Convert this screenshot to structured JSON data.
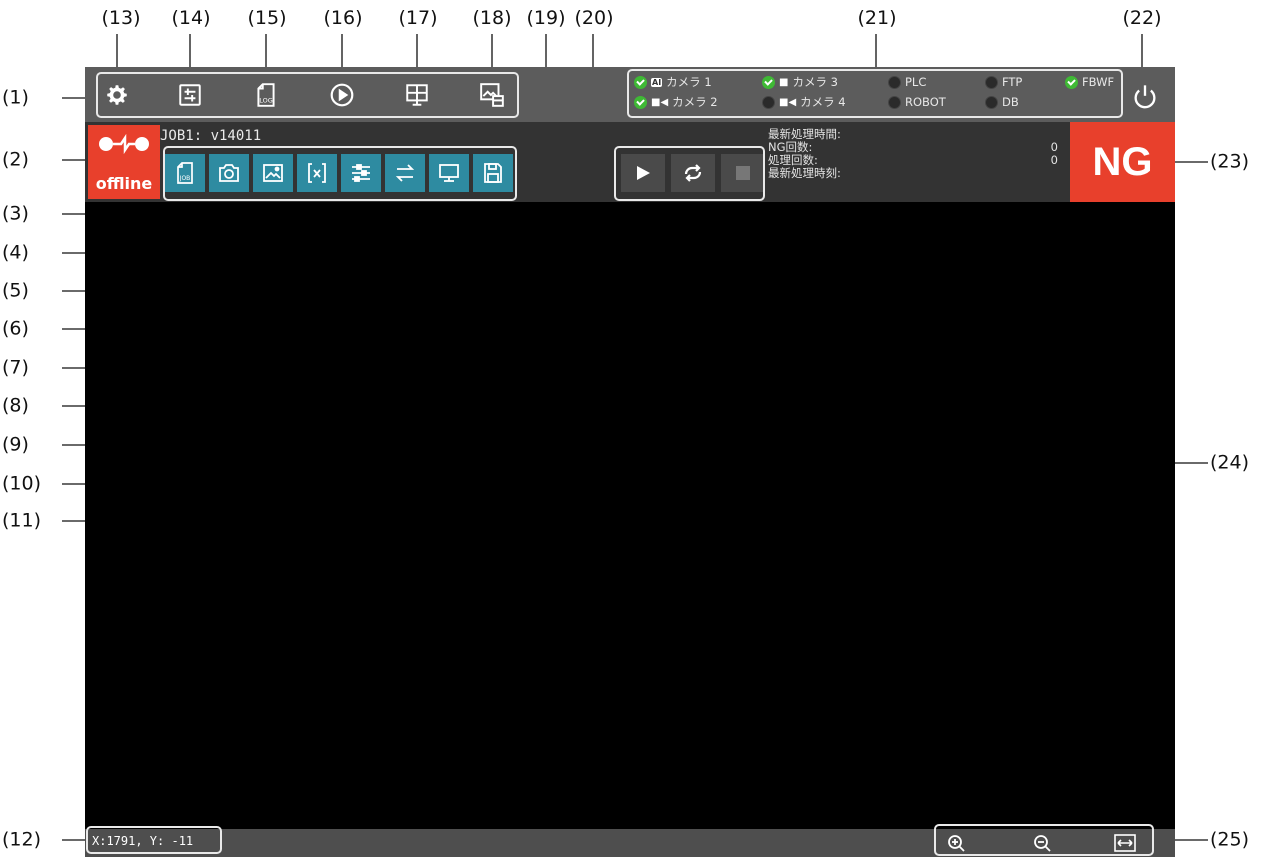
{
  "callouts": {
    "c1": "(1)",
    "c2": "(2)",
    "c3": "(3)",
    "c4": "(4)",
    "c5": "(5)",
    "c6": "(6)",
    "c7": "(7)",
    "c8": "(8)",
    "c9": "(9)",
    "c10": "(10)",
    "c11": "(11)",
    "c12": "(12)",
    "c13": "(13)",
    "c14": "(14)",
    "c15": "(15)",
    "c16": "(16)",
    "c17": "(17)",
    "c18": "(18)",
    "c19": "(19)",
    "c20": "(20)",
    "c21": "(21)",
    "c22": "(22)",
    "c23": "(23)",
    "c24": "(24)",
    "c25": "(25)"
  },
  "topbar": {
    "icons": [
      "gear-icon",
      "adjust-icon",
      "log-icon",
      "play-circle-icon",
      "monitor-grid-icon",
      "image-export-icon"
    ]
  },
  "status": {
    "items": [
      {
        "label": "カメラ 1",
        "state": "ok",
        "icon": "ai-camera-icon"
      },
      {
        "label": "カメラ 2",
        "state": "ok",
        "icon": "video-camera-icon"
      },
      {
        "label": "カメラ 3",
        "state": "ok",
        "icon": "folder-icon"
      },
      {
        "label": "カメラ 4",
        "state": "off",
        "icon": "video-camera-icon"
      },
      {
        "label": "PLC",
        "state": "off"
      },
      {
        "label": "ROBOT",
        "state": "off"
      },
      {
        "label": "FTP",
        "state": "off"
      },
      {
        "label": "DB",
        "state": "off"
      },
      {
        "label": "FBWF",
        "state": "ok"
      }
    ],
    "ai_tag": "AI"
  },
  "job": {
    "title": "JOB1: v14011",
    "offline_label": "offline",
    "toolbar_icons": [
      "job-file-icon",
      "camera-icon",
      "image-icon",
      "variable-icon",
      "flow-icon",
      "transfer-icon",
      "display-icon",
      "save-icon"
    ],
    "job_tag": "JOB",
    "log_tag": "LOG"
  },
  "stats": {
    "last_time_label": "最新処理時間:",
    "ng_count_label": "NG回数:",
    "ng_count_value": "0",
    "proc_count_label": "処理回数:",
    "proc_count_value": "0",
    "last_stamp_label": "最新処理時刻:"
  },
  "result": {
    "label": "NG"
  },
  "bottom": {
    "coords": "X:1791, Y: -11"
  },
  "colors": {
    "accent": "#2e8ba1",
    "ng": "#e8402c",
    "ok": "#3fb935"
  }
}
